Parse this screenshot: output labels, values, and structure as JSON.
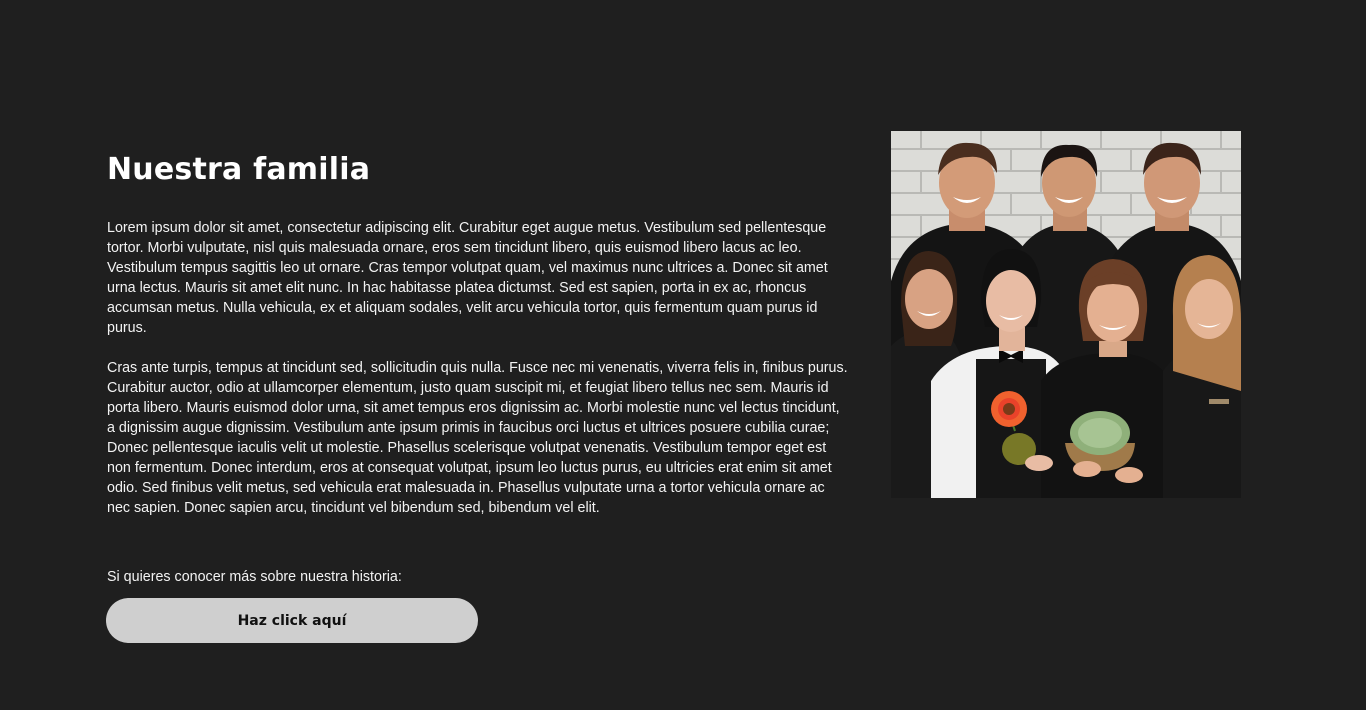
{
  "section": {
    "title": "Nuestra familia",
    "paragraphs": [
      "Lorem ipsum dolor sit amet, consectetur adipiscing elit. Curabitur eget augue metus. Vestibulum sed pellentesque tortor. Morbi vulputate, nisl quis malesuada ornare, eros sem tincidunt libero, quis euismod libero lacus ac leo. Vestibulum tempus sagittis leo ut ornare. Cras tempor volutpat quam, vel maximus nunc ultrices a. Donec sit amet urna lectus. Mauris sit amet elit nunc. In hac habitasse platea dictumst. Sed est sapien, porta in ex ac, rhoncus accumsan metus. Nulla vehicula, ex et aliquam sodales, velit arcu vehicula tortor, quis fermentum quam purus id purus.",
      "Cras ante turpis, tempus at tincidunt sed, sollicitudin quis nulla. Fusce nec mi venenatis, viverra felis in, finibus purus. Curabitur auctor, odio at ullamcorper elementum, justo quam suscipit mi, et feugiat libero tellus nec sem. Mauris id porta libero. Mauris euismod dolor urna, sit amet tempus eros dignissim ac. Morbi molestie nunc vel lectus tincidunt, a dignissim augue dignissim. Vestibulum ante ipsum primis in faucibus orci luctus et ultrices posuere cubilia curae; Donec pellentesque iaculis velit ut molestie. Phasellus scelerisque volutpat venenatis. Vestibulum tempor eget est non fermentum. Donec interdum, eros at consequat volutpat, ipsum leo luctus purus, eu ultricies erat enim sit amet odio. Sed finibus velit metus, sed vehicula erat malesuada in. Phasellus vulputate urna a tortor vehicula ornare ac nec sapien. Donec sapien arcu, tincidunt vel bibendum sed, bibendum vel elit."
    ],
    "cta_text": "Si quieres conocer más sobre nuestra historia:",
    "cta_button": "Haz click aquí"
  },
  "colors": {
    "background": "#1f1f1f",
    "text": "#ffffff",
    "button_bg": "#cfcfcf",
    "button_text": "#111111"
  }
}
